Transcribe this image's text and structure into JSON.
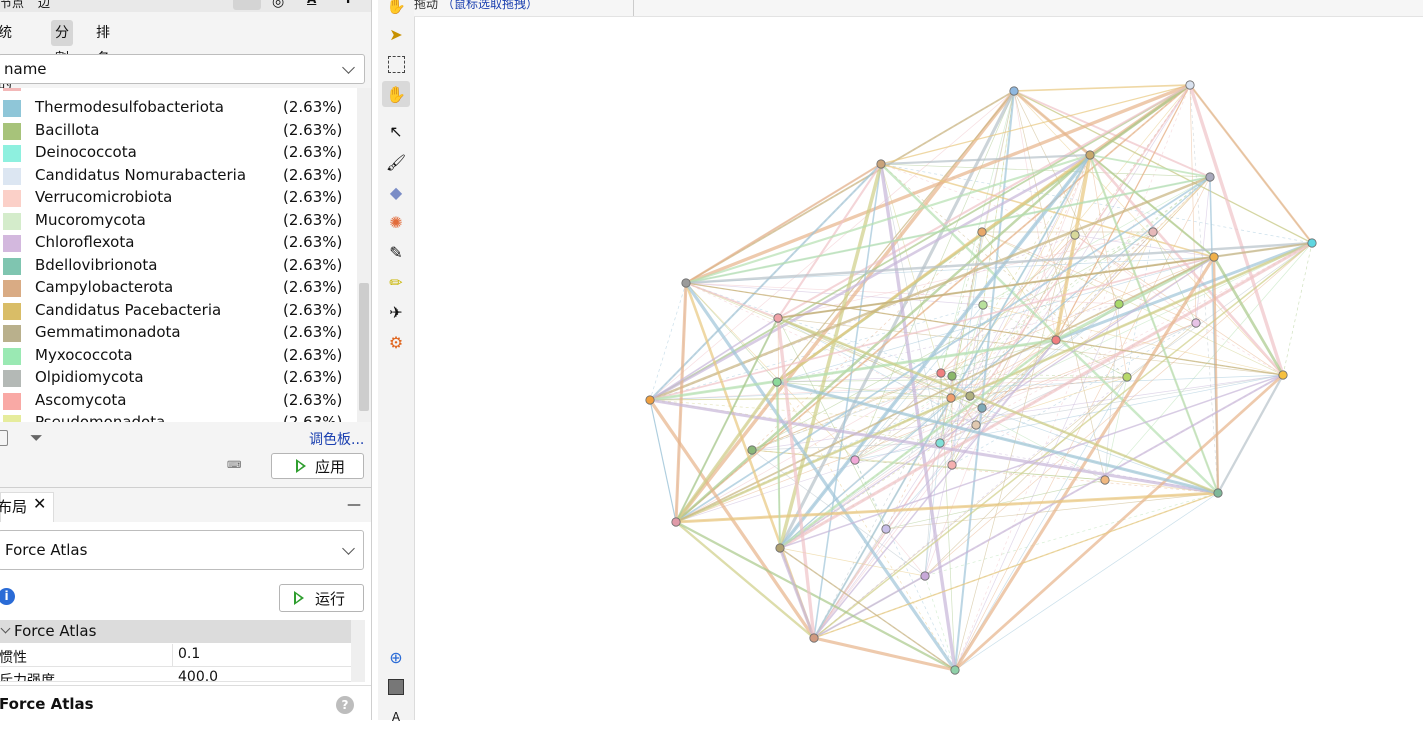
{
  "left_panel": {
    "top_tabs": [
      "节点",
      "边"
    ],
    "sub_tabs": [
      "统一的",
      "分割",
      "排名"
    ],
    "active_sub_tab": "分割",
    "attribute_select": "name",
    "legend": [
      {
        "name": "Thermodesulfobacteriota",
        "pct": "(2.63%)",
        "color": "#8fc6d8"
      },
      {
        "name": "Bacillota",
        "pct": "(2.63%)",
        "color": "#a7c37a"
      },
      {
        "name": "Deinococcota",
        "pct": "(2.63%)",
        "color": "#8ef0df"
      },
      {
        "name": "Candidatus Nomurabacteria",
        "pct": "(2.63%)",
        "color": "#dce6f2"
      },
      {
        "name": "Verrucomicrobiota",
        "pct": "(2.63%)",
        "color": "#fbd0c8"
      },
      {
        "name": "Mucoromycota",
        "pct": "(2.63%)",
        "color": "#d4eccb"
      },
      {
        "name": "Chloroflexota",
        "pct": "(2.63%)",
        "color": "#d3b8de"
      },
      {
        "name": "Bdellovibrionota",
        "pct": "(2.63%)",
        "color": "#7fc5b0"
      },
      {
        "name": "Campylobacterota",
        "pct": "(2.63%)",
        "color": "#d9ab84"
      },
      {
        "name": "Candidatus Pacebacteria",
        "pct": "(2.63%)",
        "color": "#d9bd67"
      },
      {
        "name": "Gemmatimonadota",
        "pct": "(2.63%)",
        "color": "#b9b08c"
      },
      {
        "name": "Myxococcota",
        "pct": "(2.63%)",
        "color": "#9ae9b3"
      },
      {
        "name": "Olpidiomycota",
        "pct": "(2.63%)",
        "color": "#b4b9b6"
      },
      {
        "name": "Ascomycota",
        "pct": "(2.63%)",
        "color": "#f9a9a5"
      },
      {
        "name": "Pseudomonadota",
        "pct": "(2.63%)",
        "color": "#e6ec9c"
      }
    ],
    "palette_link": "调色板...",
    "apply_button": "应用",
    "layout_tab": "布局",
    "layout_select": "Force Atlas",
    "run_button": "运行",
    "section_title": "Force Atlas",
    "properties": [
      {
        "name": "惯性",
        "value": "0.1"
      },
      {
        "name": "斥力强度",
        "value": "400.0"
      }
    ],
    "footer_title": "Force Atlas"
  },
  "canvas_header": {
    "label": "拖动",
    "hint": "（鼠标选取拖拽）"
  },
  "toolbar_icons": [
    "pointer-icon",
    "rect-select-icon",
    "drag-hand-icon",
    "edge-pencil-icon",
    "brush-icon",
    "diamond-icon",
    "color-wheel-icon",
    "pencil-icon",
    "highlighter-icon",
    "airplane-icon",
    "gear-icon",
    "zoom-icon",
    "square-icon",
    "font-icon"
  ],
  "graph_colors": {
    "edges": [
      "#c7b37f",
      "#9fc5d9",
      "#a9c98a",
      "#e7b38a",
      "#f0c3c8",
      "#b5e0b0",
      "#cfcf88",
      "#c8b7d8",
      "#b7c2c9",
      "#e8c87f"
    ]
  }
}
